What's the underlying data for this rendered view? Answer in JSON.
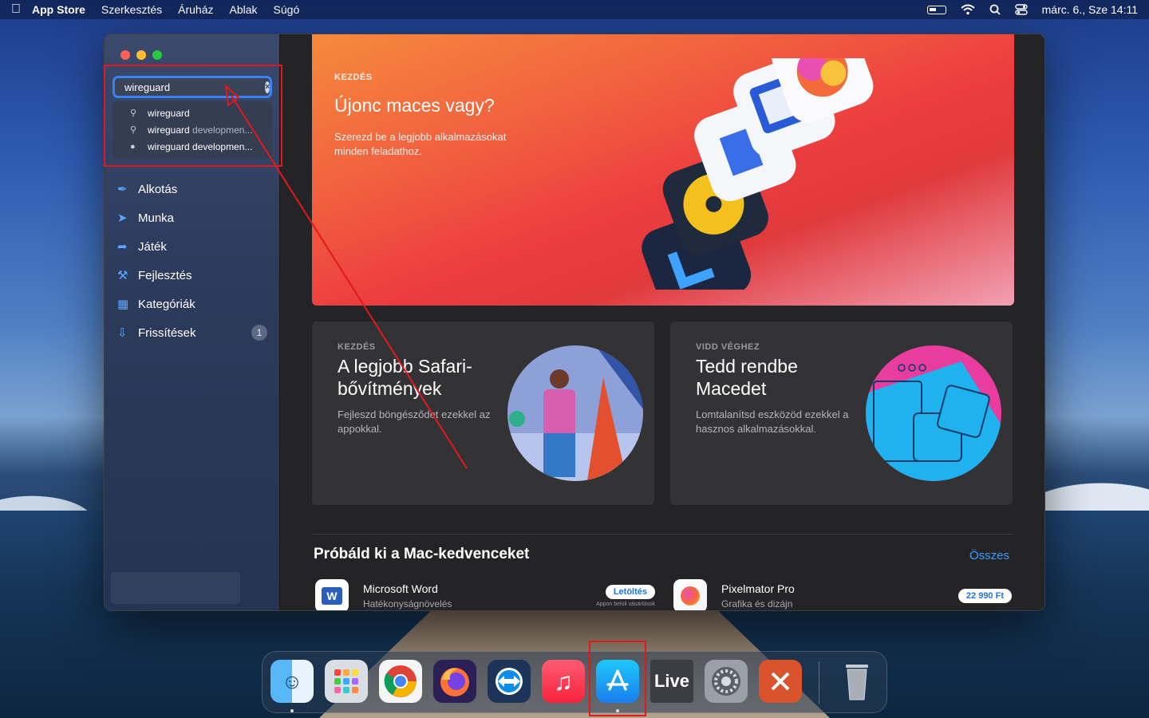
{
  "menubar": {
    "app_name": "App Store",
    "items": [
      "Szerkesztés",
      "Áruház",
      "Ablak",
      "Súgó"
    ],
    "datetime": "márc. 6., Sze  14:11"
  },
  "search": {
    "value": "wireguard",
    "suggestions": [
      {
        "main": "wireguard",
        "dim": "",
        "icon": "search-icon"
      },
      {
        "main": "wireguard",
        "dim": " developmen...",
        "icon": "search-icon"
      },
      {
        "main": "wireguard developmen...",
        "dim": "",
        "icon": "person-icon"
      }
    ]
  },
  "sidebar": {
    "items": [
      {
        "label": "Alkotás",
        "icon": "brush-icon"
      },
      {
        "label": "Munka",
        "icon": "paperplane-icon"
      },
      {
        "label": "Játék",
        "icon": "rocket-icon"
      },
      {
        "label": "Fejlesztés",
        "icon": "hammer-icon"
      },
      {
        "label": "Kategóriák",
        "icon": "grid-icon"
      },
      {
        "label": "Frissítések",
        "icon": "download-icon",
        "badge": "1"
      }
    ]
  },
  "hero": {
    "tag": "KEZDÉS",
    "title": "Újonc maces vagy?",
    "subtitle": "Szerezd be a legjobb alkalmazásokat minden feladathoz."
  },
  "cards": [
    {
      "tag": "KEZDÉS",
      "title": "A legjobb Safari-bővítmények",
      "subtitle": "Fejleszd böngésződet ezekkel az appokkal."
    },
    {
      "tag": "VIDD VÉGHEZ",
      "title": "Tedd rendbe Macedet",
      "subtitle": "Lomtalanítsd eszközöd ezekkel a hasznos alkalmazásokkal."
    }
  ],
  "section": {
    "title": "Próbáld ki a Mac-kedvenceket",
    "see_all": "Összes"
  },
  "apps": [
    {
      "name": "Microsoft Word",
      "category": "Hatékonyságnövelés",
      "button": "Letöltés",
      "note": "Appon belüli vásárlások"
    },
    {
      "name": "Pixelmator Pro",
      "category": "Grafika és dizájn",
      "button": "22 990 Ft"
    }
  ],
  "dock": {
    "apps": [
      "Finder",
      "Launchpad",
      "Chrome",
      "Firefox",
      "TeamViewer",
      "Music",
      "App Store",
      "Live",
      "System Preferences",
      "Remote Desktop",
      "Trash"
    ],
    "live_label": "Live"
  },
  "colors": {
    "accent": "#3b82f6",
    "annotation": "#e3181b",
    "link": "#3b9cff"
  }
}
